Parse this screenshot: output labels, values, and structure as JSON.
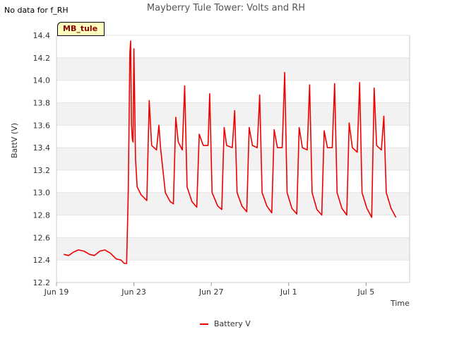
{
  "header": {
    "no_data_note": "No data for f_RH",
    "site_tag": "MB_tule"
  },
  "chart_data": {
    "type": "line",
    "title": "Mayberry Tule Tower: Volts and RH",
    "xlabel": "Time",
    "ylabel": "BattV (V)",
    "ylim": [
      12.2,
      14.4
    ],
    "yticks": [
      "12.2",
      "12.4",
      "12.6",
      "12.8",
      "13.0",
      "13.2",
      "13.4",
      "13.6",
      "13.8",
      "14.0",
      "14.2",
      "14.4"
    ],
    "xlim": [
      "2024-06-19T00:00",
      "2024-07-07T06:00"
    ],
    "xticks": [
      {
        "date": "2024-06-19T00:00",
        "label": "Jun 19"
      },
      {
        "date": "2024-06-23T00:00",
        "label": "Jun 23"
      },
      {
        "date": "2024-06-27T00:00",
        "label": "Jun 27"
      },
      {
        "date": "2024-07-01T00:00",
        "label": "Jul 1"
      },
      {
        "date": "2024-07-05T00:00",
        "label": "Jul 5"
      }
    ],
    "grid": "horizontal-bands",
    "legend_position": "bottom-center",
    "colors": {
      "series": "#ee0000",
      "band": "#f2f2f2",
      "grid": "#e4e4e4"
    },
    "series": [
      {
        "name": "Battery V",
        "points": [
          [
            "2024-06-19T09:00",
            12.45
          ],
          [
            "2024-06-19T15:00",
            12.44
          ],
          [
            "2024-06-19T21:00",
            12.47
          ],
          [
            "2024-06-20T03:00",
            12.49
          ],
          [
            "2024-06-20T10:00",
            12.48
          ],
          [
            "2024-06-20T17:00",
            12.45
          ],
          [
            "2024-06-20T23:00",
            12.44
          ],
          [
            "2024-06-21T06:00",
            12.48
          ],
          [
            "2024-06-21T12:00",
            12.49
          ],
          [
            "2024-06-21T19:00",
            12.46
          ],
          [
            "2024-06-22T02:00",
            12.41
          ],
          [
            "2024-06-22T08:00",
            12.4
          ],
          [
            "2024-06-22T12:00",
            12.37
          ],
          [
            "2024-06-22T15:00",
            12.37
          ],
          [
            "2024-06-22T17:00",
            13.0
          ],
          [
            "2024-06-22T19:00",
            14.25
          ],
          [
            "2024-06-22T20:00",
            14.35
          ],
          [
            "2024-06-22T21:00",
            13.6
          ],
          [
            "2024-06-22T22:00",
            13.48
          ],
          [
            "2024-06-22T23:00",
            13.45
          ],
          [
            "2024-06-23T00:00",
            14.28
          ],
          [
            "2024-06-23T02:00",
            13.3
          ],
          [
            "2024-06-23T04:00",
            13.05
          ],
          [
            "2024-06-23T09:00",
            12.98
          ],
          [
            "2024-06-23T16:00",
            12.93
          ],
          [
            "2024-06-23T19:00",
            13.82
          ],
          [
            "2024-06-23T22:00",
            13.42
          ],
          [
            "2024-06-24T04:00",
            13.38
          ],
          [
            "2024-06-24T07:00",
            13.6
          ],
          [
            "2024-06-24T09:00",
            13.4
          ],
          [
            "2024-06-24T15:00",
            13.0
          ],
          [
            "2024-06-24T21:00",
            12.92
          ],
          [
            "2024-06-25T01:00",
            12.9
          ],
          [
            "2024-06-25T04:00",
            13.67
          ],
          [
            "2024-06-25T07:00",
            13.45
          ],
          [
            "2024-06-25T12:00",
            13.38
          ],
          [
            "2024-06-25T15:00",
            13.95
          ],
          [
            "2024-06-25T18:00",
            13.05
          ],
          [
            "2024-06-26T00:00",
            12.92
          ],
          [
            "2024-06-26T06:00",
            12.87
          ],
          [
            "2024-06-26T09:00",
            13.52
          ],
          [
            "2024-06-26T14:00",
            13.42
          ],
          [
            "2024-06-26T20:00",
            13.42
          ],
          [
            "2024-06-26T22:00",
            13.88
          ],
          [
            "2024-06-27T01:00",
            13.0
          ],
          [
            "2024-06-27T08:00",
            12.88
          ],
          [
            "2024-06-27T13:00",
            12.85
          ],
          [
            "2024-06-27T16:00",
            13.58
          ],
          [
            "2024-06-27T19:00",
            13.42
          ],
          [
            "2024-06-28T02:00",
            13.4
          ],
          [
            "2024-06-28T05:00",
            13.73
          ],
          [
            "2024-06-28T08:00",
            13.0
          ],
          [
            "2024-06-28T14:00",
            12.88
          ],
          [
            "2024-06-28T20:00",
            12.83
          ],
          [
            "2024-06-28T23:00",
            13.58
          ],
          [
            "2024-06-29T03:00",
            13.42
          ],
          [
            "2024-06-29T09:00",
            13.4
          ],
          [
            "2024-06-29T12:00",
            13.87
          ],
          [
            "2024-06-29T15:00",
            13.0
          ],
          [
            "2024-06-29T21:00",
            12.88
          ],
          [
            "2024-06-30T03:00",
            12.82
          ],
          [
            "2024-06-30T06:00",
            13.56
          ],
          [
            "2024-06-30T10:00",
            13.4
          ],
          [
            "2024-06-30T16:00",
            13.4
          ],
          [
            "2024-06-30T19:00",
            14.07
          ],
          [
            "2024-06-30T22:00",
            13.0
          ],
          [
            "2024-07-01T04:00",
            12.86
          ],
          [
            "2024-07-01T10:00",
            12.81
          ],
          [
            "2024-07-01T13:00",
            13.58
          ],
          [
            "2024-07-01T17:00",
            13.4
          ],
          [
            "2024-07-01T23:00",
            13.38
          ],
          [
            "2024-07-02T02:00",
            13.96
          ],
          [
            "2024-07-02T05:00",
            13.0
          ],
          [
            "2024-07-02T11:00",
            12.85
          ],
          [
            "2024-07-02T17:00",
            12.8
          ],
          [
            "2024-07-02T20:00",
            13.55
          ],
          [
            "2024-07-03T00:00",
            13.4
          ],
          [
            "2024-07-03T06:00",
            13.4
          ],
          [
            "2024-07-03T09:00",
            13.97
          ],
          [
            "2024-07-03T12:00",
            13.0
          ],
          [
            "2024-07-03T18:00",
            12.86
          ],
          [
            "2024-07-04T00:00",
            12.8
          ],
          [
            "2024-07-04T03:00",
            13.62
          ],
          [
            "2024-07-04T07:00",
            13.4
          ],
          [
            "2024-07-04T13:00",
            13.36
          ],
          [
            "2024-07-04T16:00",
            13.98
          ],
          [
            "2024-07-04T19:00",
            13.0
          ],
          [
            "2024-07-05T01:00",
            12.86
          ],
          [
            "2024-07-05T07:00",
            12.78
          ],
          [
            "2024-07-05T10:00",
            13.93
          ],
          [
            "2024-07-05T13:00",
            13.42
          ],
          [
            "2024-07-05T19:00",
            13.38
          ],
          [
            "2024-07-05T22:00",
            13.68
          ],
          [
            "2024-07-06T01:00",
            13.0
          ],
          [
            "2024-07-06T07:00",
            12.86
          ],
          [
            "2024-07-06T13:00",
            12.78
          ]
        ]
      }
    ]
  }
}
